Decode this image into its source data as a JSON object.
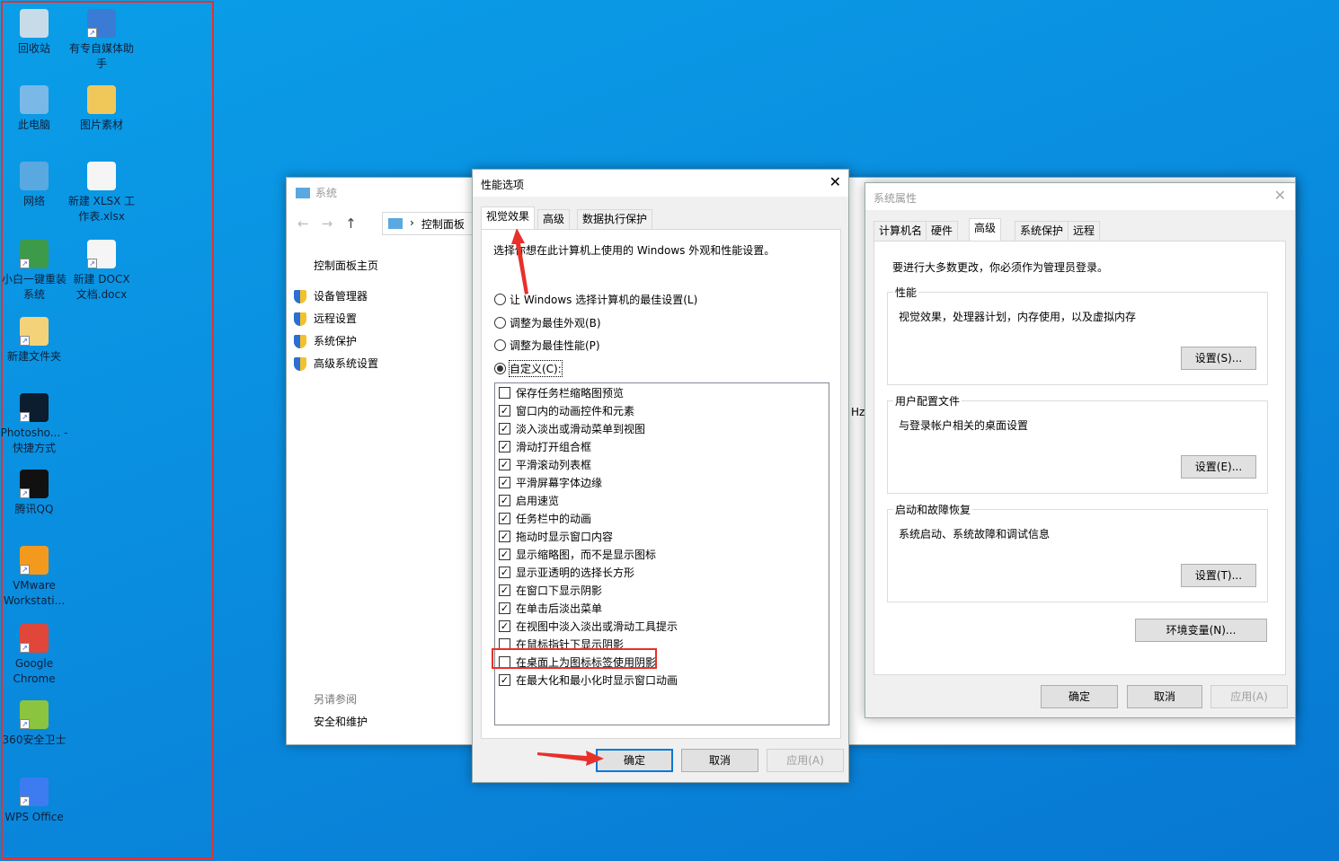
{
  "desktop": {
    "icons": [
      {
        "label": "回收站",
        "icon": "recycle-bin-icon",
        "color": "#c7dce8"
      },
      {
        "label": "有专自媒体助手",
        "icon": "app-shortcut-icon",
        "color": "#3a7bd5"
      },
      {
        "label": "此电脑",
        "icon": "computer-icon",
        "color": "#7ab8e8"
      },
      {
        "label": "图片素材",
        "icon": "folder-icon",
        "color": "#f0c85a"
      },
      {
        "label": "网络",
        "icon": "network-icon",
        "color": "#5aa8e0"
      },
      {
        "label": "新建 XLSX 工作表.xlsx",
        "icon": "xlsx-file-icon",
        "color": "#f5f5f5"
      },
      {
        "label": "小白一键重装系统",
        "icon": "app-shortcut-icon",
        "color": "#3c9a4a"
      },
      {
        "label": "新建 DOCX 文档.docx",
        "icon": "docx-file-icon",
        "color": "#f5f5f5"
      },
      {
        "label": "新建文件夹",
        "icon": "folder-icon",
        "color": "#f3d27a"
      },
      {
        "label": "Photosho... - 快捷方式",
        "icon": "photoshop-icon",
        "color": "#0b1d2e"
      },
      {
        "label": "腾讯QQ",
        "icon": "qq-icon",
        "color": "#111"
      },
      {
        "label": "VMware Workstati...",
        "icon": "vmware-icon",
        "color": "#f39a1e"
      },
      {
        "label": "Google Chrome",
        "icon": "chrome-icon",
        "color": "#e0463a"
      },
      {
        "label": "360安全卫士",
        "icon": "360-icon",
        "color": "#8bc43f"
      },
      {
        "label": "WPS Office",
        "icon": "wps-icon",
        "color": "#3d7cf0"
      }
    ]
  },
  "system_window": {
    "title": "系统",
    "breadcrumb": "控制面板",
    "home": "控制面板主页",
    "links": [
      "设备管理器",
      "远程设置",
      "系统保护",
      "高级系统设置"
    ],
    "see_also": "另请参阅",
    "see_also_link": "安全和维护",
    "partial": "Hz"
  },
  "perf": {
    "title": "性能选项",
    "tabs": [
      "视觉效果",
      "高级",
      "数据执行保护"
    ],
    "desc": "选择你想在此计算机上使用的 Windows 外观和性能设置。",
    "radios": [
      {
        "label": "让 Windows 选择计算机的最佳设置(L)",
        "on": false
      },
      {
        "label": "调整为最佳外观(B)",
        "on": false
      },
      {
        "label": "调整为最佳性能(P)",
        "on": false
      },
      {
        "label": "自定义(C):",
        "on": true
      }
    ],
    "options": [
      {
        "label": "保存任务栏缩略图预览",
        "checked": false
      },
      {
        "label": "窗口内的动画控件和元素",
        "checked": true
      },
      {
        "label": "淡入淡出或滑动菜单到视图",
        "checked": true
      },
      {
        "label": "滑动打开组合框",
        "checked": true
      },
      {
        "label": "平滑滚动列表框",
        "checked": true
      },
      {
        "label": "平滑屏幕字体边缘",
        "checked": true
      },
      {
        "label": "启用速览",
        "checked": true
      },
      {
        "label": "任务栏中的动画",
        "checked": true
      },
      {
        "label": "拖动时显示窗口内容",
        "checked": true
      },
      {
        "label": "显示缩略图，而不是显示图标",
        "checked": true
      },
      {
        "label": "显示亚透明的选择长方形",
        "checked": true
      },
      {
        "label": "在窗口下显示阴影",
        "checked": true
      },
      {
        "label": "在单击后淡出菜单",
        "checked": true
      },
      {
        "label": "在视图中淡入淡出或滑动工具提示",
        "checked": true
      },
      {
        "label": "在鼠标指针下显示阴影",
        "checked": false
      },
      {
        "label": "在桌面上为图标标签使用阴影",
        "checked": false
      },
      {
        "label": "在最大化和最小化时显示窗口动画",
        "checked": true
      }
    ],
    "ok": "确定",
    "cancel": "取消",
    "apply": "应用(A)"
  },
  "sysprops": {
    "title": "系统属性",
    "tabs": [
      "计算机名",
      "硬件",
      "高级",
      "系统保护",
      "远程"
    ],
    "admin_note": "要进行大多数更改，你必须作为管理员登录。",
    "groups": [
      {
        "title": "性能",
        "desc": "视觉效果，处理器计划，内存使用，以及虚拟内存",
        "button": "设置(S)..."
      },
      {
        "title": "用户配置文件",
        "desc": "与登录帐户相关的桌面设置",
        "button": "设置(E)..."
      },
      {
        "title": "启动和故障恢复",
        "desc": "系统启动、系统故障和调试信息",
        "button": "设置(T)..."
      }
    ],
    "env": "环境变量(N)...",
    "ok": "确定",
    "cancel": "取消",
    "apply": "应用(A)"
  },
  "colors": {
    "annotation": "#e8302a",
    "accent": "#0078d7"
  }
}
